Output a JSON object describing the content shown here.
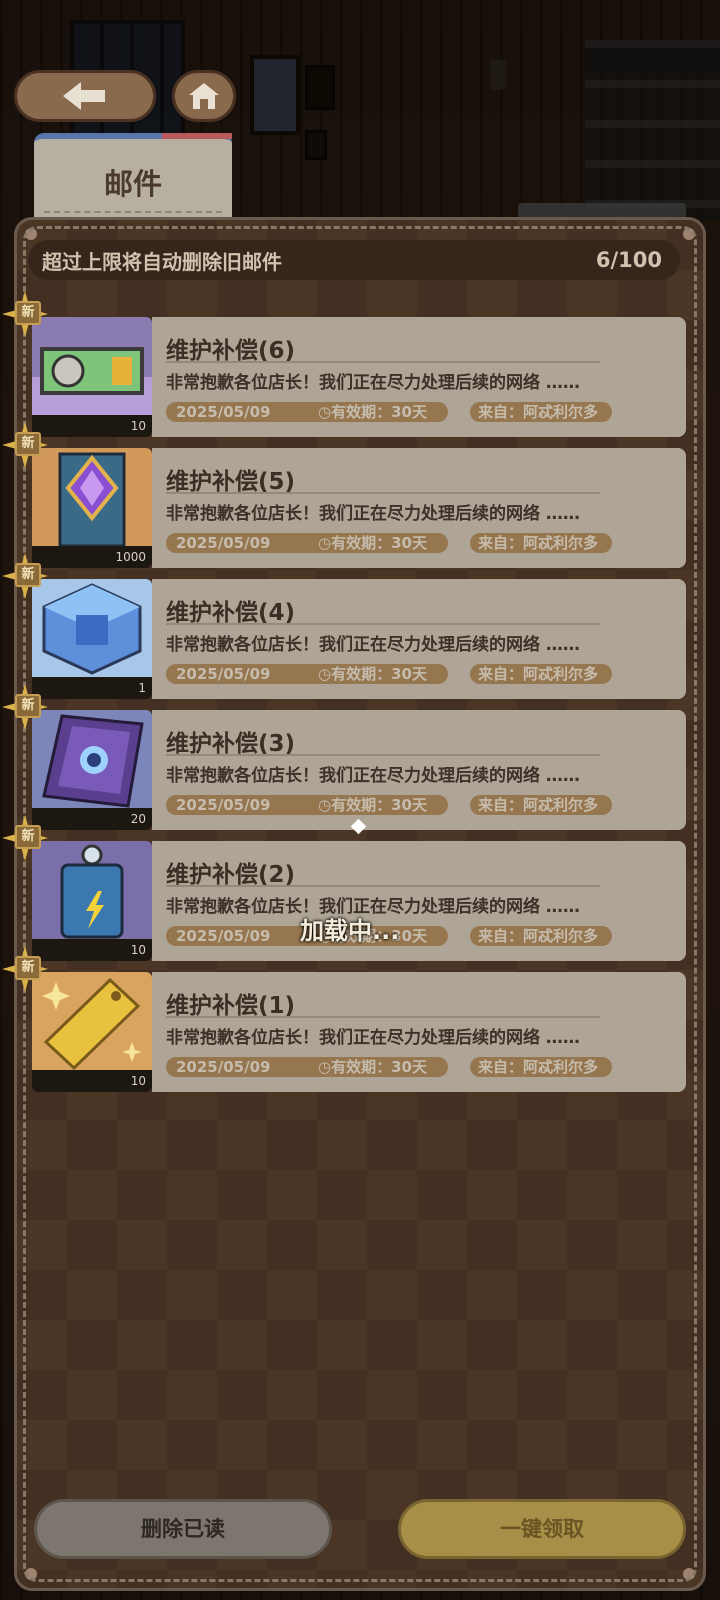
{
  "header": {
    "tab_label": "邮件"
  },
  "mailbox": {
    "limit_text": "超过上限将自动删除旧邮件",
    "count": "6/100"
  },
  "mails": [
    {
      "title": "维护补偿(6)",
      "preview": "非常抱歉各位店长！我们正在尽力处理后续的网络 ……",
      "date": "2025/05/09",
      "expiry": "有效期：30天",
      "from": "来自：阿忒利尔多",
      "qty": "10",
      "badge": "新",
      "icon": "gift-box-icon"
    },
    {
      "title": "维护补偿(5)",
      "preview": "非常抱歉各位店长！我们正在尽力处理后续的网络 ……",
      "date": "2025/05/09",
      "expiry": "有效期：30天",
      "from": "来自：阿忒利尔多",
      "qty": "1000",
      "badge": "新",
      "icon": "purple-gem-banner-icon"
    },
    {
      "title": "维护补偿(4)",
      "preview": "非常抱歉各位店长！我们正在尽力处理后续的网络 ……",
      "date": "2025/05/09",
      "expiry": "有效期：30天",
      "from": "来自：阿忒利尔多",
      "qty": "1",
      "badge": "新",
      "icon": "blue-crystal-cube-icon"
    },
    {
      "title": "维护补偿(3)",
      "preview": "非常抱歉各位店长！我们正在尽力处理后续的网络 ……",
      "date": "2025/05/09",
      "expiry": "有效期：30天",
      "from": "来自：阿忒利尔多",
      "qty": "20",
      "badge": "新",
      "icon": "purple-book-icon"
    },
    {
      "title": "维护补偿(2)",
      "preview": "非常抱歉各位店长！我们正在尽力处理后续的网络 ……",
      "date": "2025/05/09",
      "expiry": "有效期：30天",
      "from": "来自：阿忒利尔多",
      "qty": "10",
      "badge": "新",
      "icon": "energy-bottle-icon"
    },
    {
      "title": "维护补偿(1)",
      "preview": "非常抱歉各位店长！我们正在尽力处理后续的网络 ……",
      "date": "2025/05/09",
      "expiry": "有效期：30天",
      "from": "来自：阿忒利尔多",
      "qty": "10",
      "badge": "新",
      "icon": "golden-ticket-icon"
    }
  ],
  "loading": {
    "text": "加载中..."
  },
  "footer": {
    "delete_read_label": "删除已读",
    "claim_all_label": "一键领取"
  },
  "colors": {
    "panel_bg": "#4b3626",
    "card_bg": "#aea597",
    "badge_bg": "#8b6a3a",
    "claim_button": "#a88f48",
    "delete_button": "#7d766e"
  }
}
